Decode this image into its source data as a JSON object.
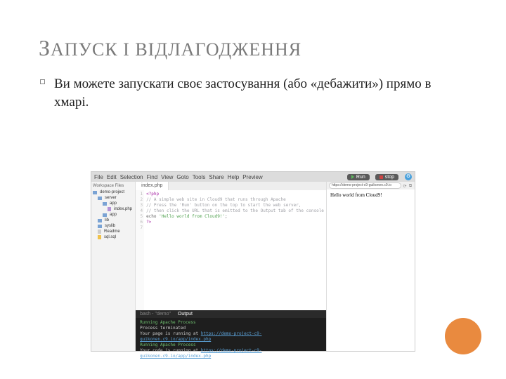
{
  "title": {
    "cap1": "З",
    "rest1": "АПУСК І ВІДЛАГОДЖЕННЯ"
  },
  "body_text": "Ви можете запускати своє застосування (або «дебажити») прямо в хмарі.",
  "menubar": [
    "File",
    "Edit",
    "Selection",
    "Find",
    "View",
    "Goto",
    "Tools",
    "Share",
    "Help",
    "Preview"
  ],
  "run_label": "Run",
  "stop_label": "stop",
  "sidebar": {
    "title": "Workspace Files",
    "items": [
      {
        "l": 0,
        "t": "fld",
        "label": "demo-project"
      },
      {
        "l": 1,
        "t": "fld",
        "label": "server"
      },
      {
        "l": 2,
        "t": "fld",
        "label": "app"
      },
      {
        "l": 3,
        "t": "php",
        "label": "index.php"
      },
      {
        "l": 2,
        "t": "fld",
        "label": "app"
      },
      {
        "l": 1,
        "t": "fld",
        "label": "lib"
      },
      {
        "l": 1,
        "t": "fld",
        "label": "syslib"
      },
      {
        "l": 1,
        "t": "txt",
        "label": "Readme"
      },
      {
        "l": 1,
        "t": "sql",
        "label": "sql.sql"
      }
    ]
  },
  "editor": {
    "tab": "index.php",
    "gutter": [
      "1",
      "2",
      "3",
      "4",
      "5",
      "6",
      "7"
    ],
    "code": [
      {
        "cls": "kw",
        "text": "<?php"
      },
      {
        "cls": "cm",
        "text": "// A simple web site in Cloud9 that runs through Apache"
      },
      {
        "cls": "cm",
        "text": "// Press the 'Run' button on the top to start the web server,"
      },
      {
        "cls": "cm",
        "text": "// then click the URL that is emitted to the Output tab of the console"
      },
      {
        "cls": "",
        "text": ""
      },
      {
        "cls": "",
        "pre": "echo ",
        "str": "'Hello world from Cloud9!'",
        "post": ";"
      },
      {
        "cls": "kw",
        "text": "?>"
      }
    ]
  },
  "console": {
    "tabs": [
      "bash - \"demo\"",
      "Output"
    ],
    "lines": [
      {
        "a": "Running Apache Process",
        "cls": "ok"
      },
      {
        "a": "Process terminated"
      },
      {
        "a": "Your page is running at ",
        "link": "https://demo-project-c9-guikonen.c9.io/app/index.php"
      },
      {
        "a": "Running Apache Process",
        "cls": "ok"
      },
      {
        "a": "Your code is running at ",
        "link": "https://demo-project-c9-guikonen.c9.io/app/index.php"
      }
    ]
  },
  "preview": {
    "url": "https://demo-project-c9-guikonen.c9.io",
    "page_text": "Hello world from Cloud9!"
  }
}
